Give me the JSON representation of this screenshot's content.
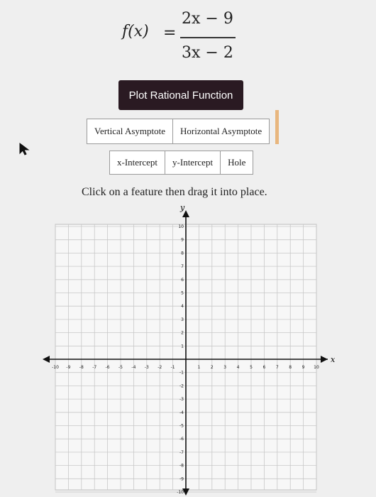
{
  "formula": {
    "lhs": "f(x)",
    "equals": "=",
    "numerator": "2x − 9",
    "denominator": "3x − 2"
  },
  "plot_button": "Plot Rational Function",
  "features_row1": [
    "Vertical Asymptote",
    "Horizontal Asymptote"
  ],
  "features_row2": [
    "x-Intercept",
    "y-Intercept",
    "Hole"
  ],
  "instruction": "Click on a feature then drag it into place.",
  "graph": {
    "x_axis_label": "x",
    "y_axis_label": "y",
    "x_min": -10,
    "x_max": 10,
    "y_min": -10,
    "y_max": 10,
    "x_tick_labels": [
      "-10",
      "-9",
      "-8",
      "-7",
      "-6",
      "-5",
      "-4",
      "-3",
      "-2",
      "-1",
      "1",
      "2",
      "3",
      "4",
      "5",
      "6",
      "7",
      "8",
      "9",
      "10"
    ],
    "y_tick_labels": [
      "10",
      "9",
      "8",
      "7",
      "6",
      "5",
      "4",
      "3",
      "2",
      "1",
      "-1",
      "-2",
      "-3",
      "-4",
      "-5",
      "-6",
      "-7",
      "-8",
      "-9",
      "-10"
    ],
    "grid": true
  },
  "colors": {
    "plot_button_bg": "#2a1a22",
    "background": "#efefef",
    "grid_line": "#c8c8c8"
  }
}
